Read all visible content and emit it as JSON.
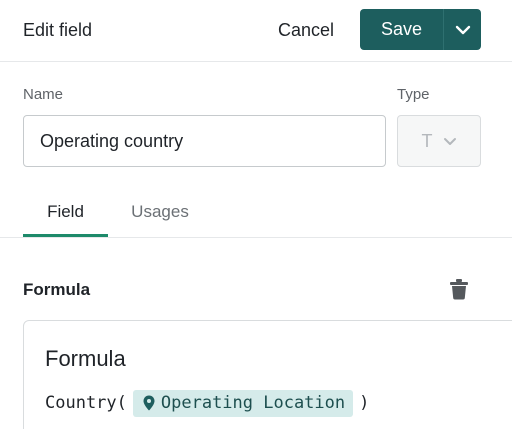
{
  "header": {
    "title": "Edit field",
    "cancel_label": "Cancel",
    "save_label": "Save"
  },
  "form": {
    "name_label": "Name",
    "name_value": "Operating country",
    "type_label": "Type",
    "type_value": "T"
  },
  "tabs": [
    {
      "label": "Field",
      "active": true
    },
    {
      "label": "Usages",
      "active": false
    }
  ],
  "formula": {
    "section_title": "Formula",
    "heading": "Formula",
    "function_open": "Country(",
    "reference": "Operating Location",
    "function_close": ")"
  },
  "colors": {
    "primary": "#1d5e5e",
    "tab_active": "#1d8a6a",
    "chip_bg": "#d5ebea"
  },
  "icons": [
    "chevron-down-icon",
    "trash-icon",
    "location-pin-icon"
  ]
}
